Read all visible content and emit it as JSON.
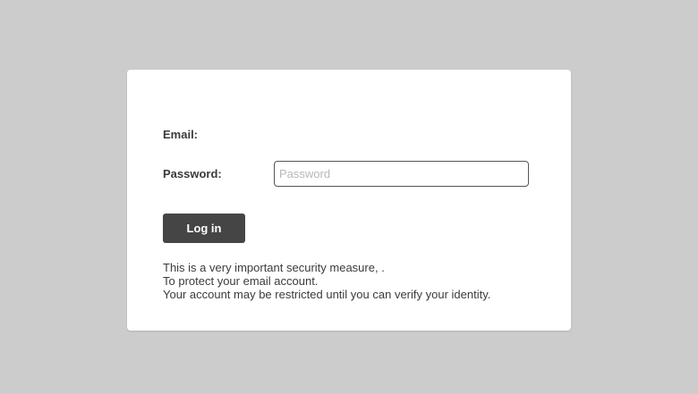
{
  "form": {
    "email_label": "Email:",
    "password_label": "Password:",
    "password_placeholder": "Password",
    "password_value": "",
    "login_label": "Log in"
  },
  "notice": {
    "line1": "This is a very important security measure, .",
    "line2": "To protect your email account.",
    "line3": "Your account may be restricted until you can verify your identity."
  },
  "colors": {
    "page_background": "#cccccc",
    "card_background": "#ffffff",
    "button_background": "#454545",
    "button_text": "#ffffff",
    "text": "#3b3b3b"
  }
}
